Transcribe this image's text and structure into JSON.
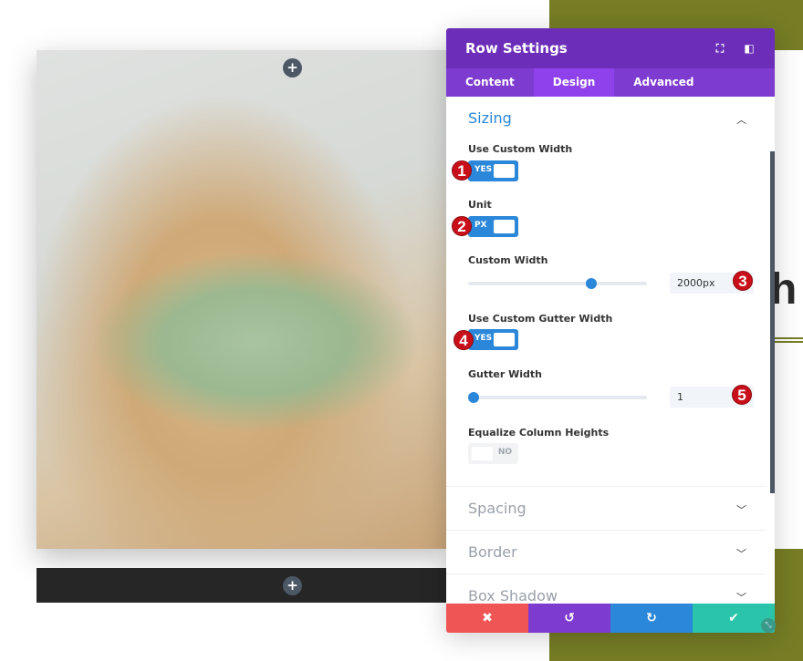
{
  "panel": {
    "title": "Row Settings",
    "tabs": [
      {
        "label": "Content"
      },
      {
        "label": "Design"
      },
      {
        "label": "Advanced"
      }
    ],
    "sizing": {
      "title": "Sizing",
      "use_custom_width": {
        "label": "Use Custom Width",
        "value": "YES"
      },
      "unit": {
        "label": "Unit",
        "value": "PX"
      },
      "custom_width": {
        "label": "Custom Width",
        "value": "2000px",
        "slider_fraction": 0.7
      },
      "use_custom_gutter": {
        "label": "Use Custom Gutter Width",
        "value": "YES"
      },
      "gutter_width": {
        "label": "Gutter Width",
        "value": "1",
        "slider_fraction": 0.0
      },
      "equalize": {
        "label": "Equalize Column Heights",
        "value": "NO"
      }
    },
    "sections": [
      {
        "label": "Spacing"
      },
      {
        "label": "Border"
      },
      {
        "label": "Box Shadow"
      }
    ],
    "footer": {
      "cancel": "✖",
      "undo": "↺",
      "redo": "↻",
      "save": "✔"
    }
  },
  "badges": [
    "1",
    "2",
    "3",
    "4",
    "5"
  ],
  "page": {
    "heading_fragment": "th",
    "add_icon": "+"
  },
  "colors": {
    "header": "#6c2eb9",
    "accent": "#2b87da",
    "olive": "#767d25",
    "cancel": "#ef5555",
    "undo": "#7e3bd0",
    "redo": "#2b87da",
    "save": "#29c4a9"
  }
}
